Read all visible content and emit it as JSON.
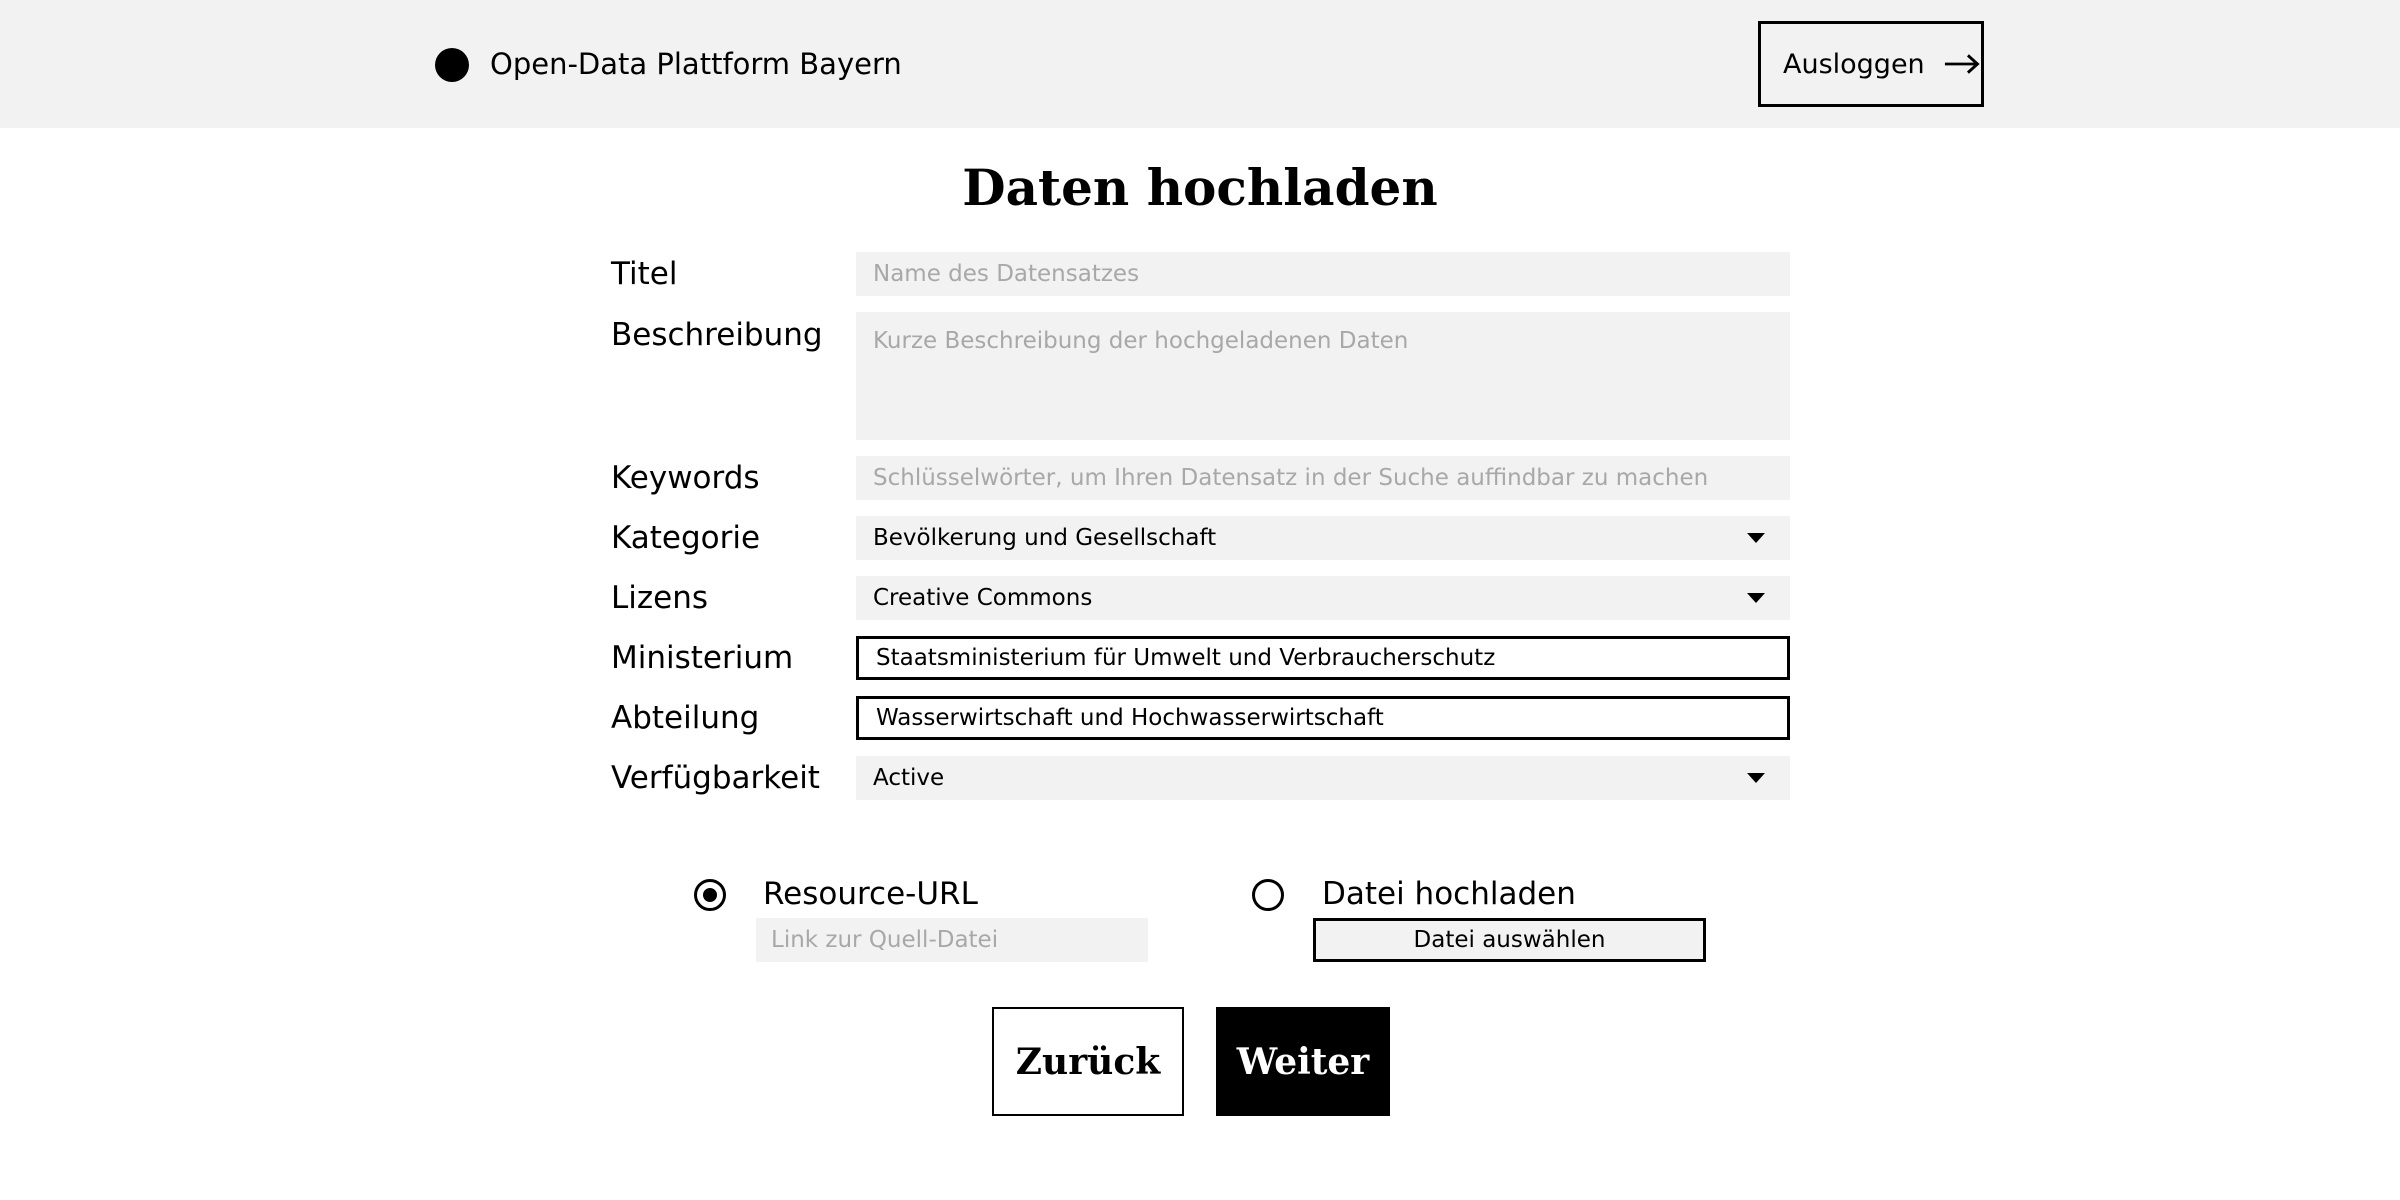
{
  "header": {
    "app_title": "Open-Data Plattform Bayern",
    "logout_label": "Ausloggen"
  },
  "page": {
    "title": "Daten hochladen"
  },
  "form": {
    "titel": {
      "label": "Titel",
      "placeholder": "Name des Datensatzes"
    },
    "beschreibung": {
      "label": "Beschreibung",
      "placeholder": "Kurze Beschreibung der hochgeladenen Daten"
    },
    "keywords": {
      "label": "Keywords",
      "placeholder": "Schlüsselwörter, um Ihren Datensatz in der Suche auffindbar zu machen"
    },
    "kategorie": {
      "label": "Kategorie",
      "value": "Bevölkerung und Gesellschaft"
    },
    "lizens": {
      "label": "Lizens",
      "value": "Creative Commons"
    },
    "ministerium": {
      "label": "Ministerium",
      "value": "Staatsministerium für Umwelt und Verbraucherschutz"
    },
    "abteilung": {
      "label": "Abteilung",
      "value": "Wasserwirtschaft und Hochwasserwirtschaft"
    },
    "verfuegbarkeit": {
      "label": "Verfügbarkeit",
      "value": "Active"
    }
  },
  "source": {
    "url_option": {
      "label": "Resource-URL",
      "selected": true,
      "placeholder": "Link zur Quell-Datei"
    },
    "file_option": {
      "label": "Datei hochladen",
      "selected": false,
      "button_label": "Datei auswählen"
    }
  },
  "actions": {
    "back_label": "Zurück",
    "next_label": "Weiter"
  }
}
